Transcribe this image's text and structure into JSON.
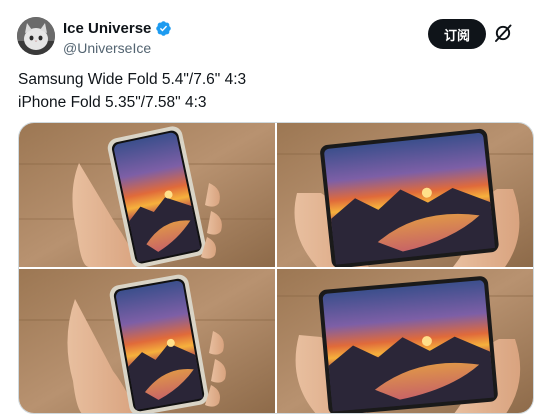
{
  "author": {
    "display_name": "Ice Universe",
    "handle": "@UniverseIce",
    "verified": true,
    "avatar_icon": "cat-avatar-icon",
    "verified_icon": "verified-badge-icon",
    "verified_color": "#1d9bf0"
  },
  "header_actions": {
    "subscribe_label": "订阅",
    "grok_icon": "grok-icon"
  },
  "tweet": {
    "lines": [
      "Samsung Wide Fold 5.4\"/7.6\" 4:3",
      "iPhone Fold 5.35\"/7.58\" 4:3"
    ]
  },
  "media": {
    "images": [
      {
        "description": "hand holding tall narrow foldable phone showing sunset lake wallpaper"
      },
      {
        "description": "hands holding unfolded foldable phone showing sunset mountain lake wallpaper"
      },
      {
        "description": "hand holding narrow foldable phone showing sunset lake wallpaper"
      },
      {
        "description": "hands holding unfolded foldable phone showing sunset mountain lake wallpaper"
      }
    ]
  },
  "colors": {
    "text_primary": "#0f1419",
    "text_secondary": "#536471",
    "button_bg": "#0f1419",
    "border": "#cfd9de"
  }
}
